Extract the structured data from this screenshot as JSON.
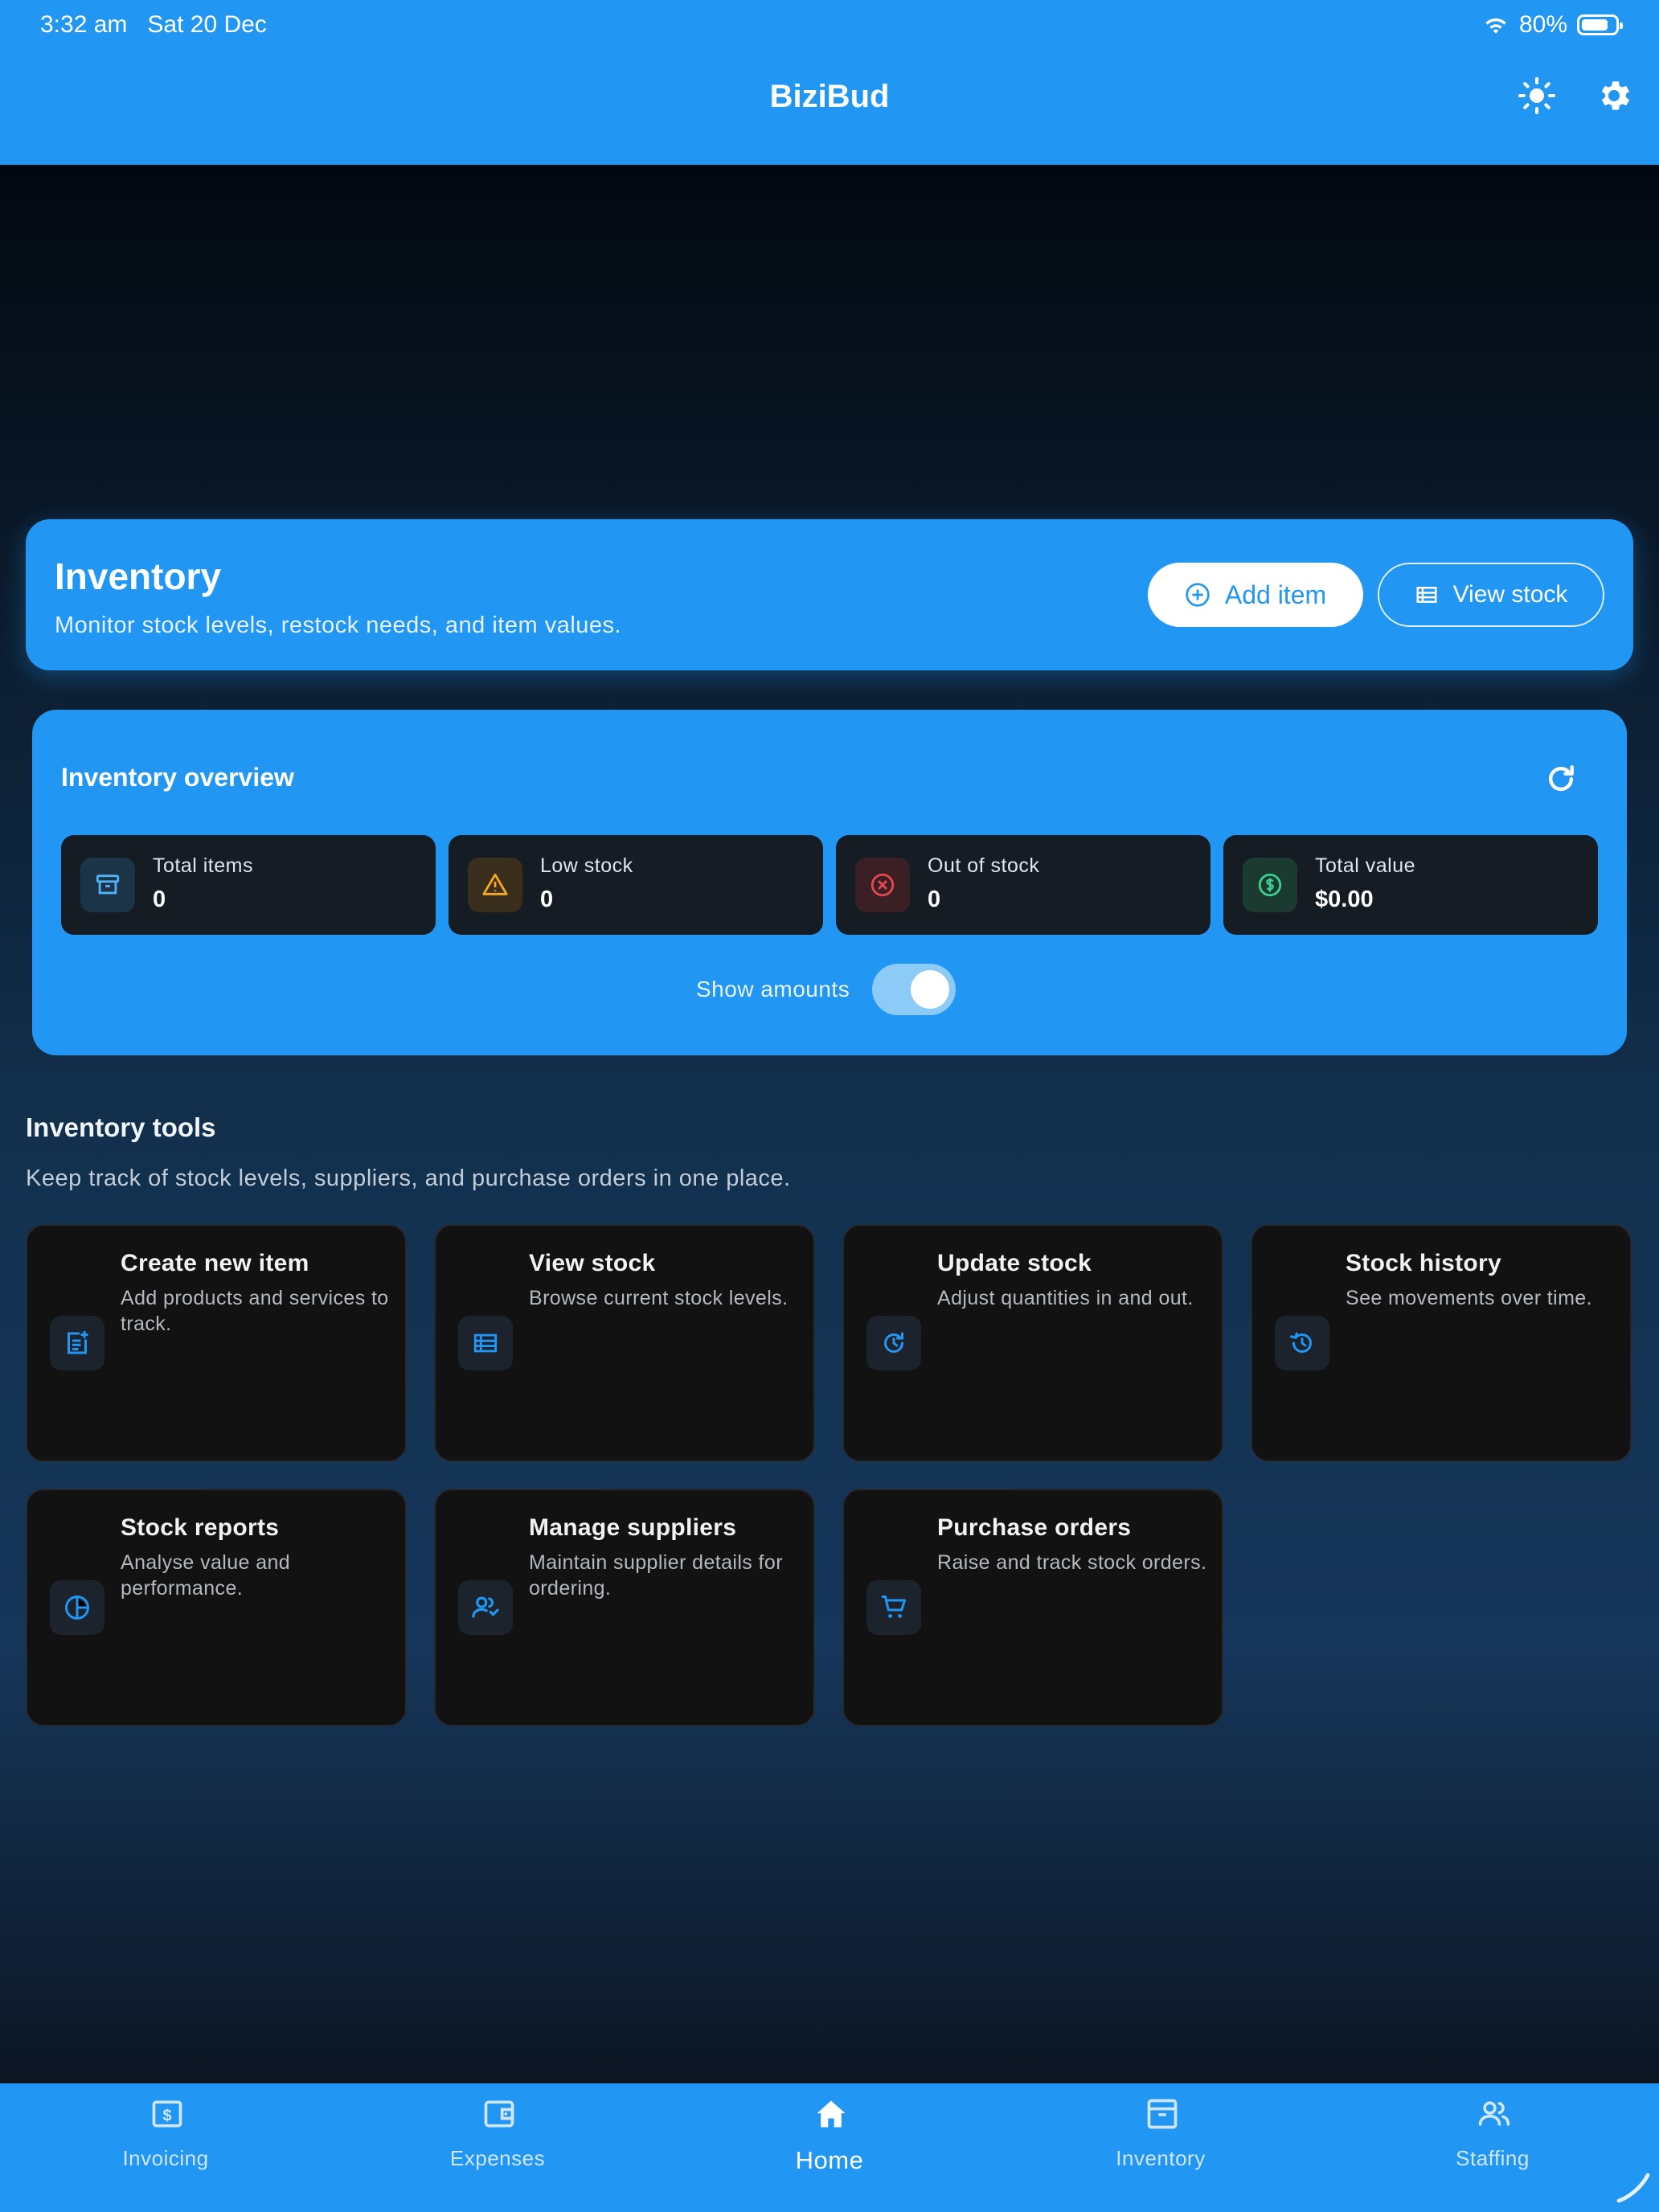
{
  "status_bar": {
    "time": "3:32 am",
    "date": "Sat 20 Dec",
    "battery": "80%"
  },
  "app": {
    "title": "BiziBud"
  },
  "hero": {
    "title": "Inventory",
    "subtitle": "Monitor stock levels, restock needs, and item values.",
    "add_label": "Add item",
    "view_label": "View stock"
  },
  "overview": {
    "title": "Inventory overview",
    "stats": [
      {
        "label": "Total items",
        "value": "0",
        "icon": "archive-icon",
        "color": "#4fb3f6"
      },
      {
        "label": "Low stock",
        "value": "0",
        "icon": "warning-icon",
        "color": "#f5a623"
      },
      {
        "label": "Out of stock",
        "value": "0",
        "icon": "x-circle-icon",
        "color": "#e5484d"
      },
      {
        "label": "Total value",
        "value": "$0.00",
        "icon": "dollar-circle-icon",
        "color": "#3ecf8e"
      }
    ],
    "toggle_label": "Show amounts",
    "toggle_on": true
  },
  "tools": {
    "title": "Inventory tools",
    "subtitle": "Keep track of stock levels, suppliers, and purchase orders in one place.",
    "items": [
      {
        "title": "Create new item",
        "desc": "Add products and services to track.",
        "icon": "note-add-icon"
      },
      {
        "title": "View stock",
        "desc": "Browse current stock levels.",
        "icon": "list-table-icon"
      },
      {
        "title": "Update stock",
        "desc": "Adjust quantities in and out.",
        "icon": "update-icon"
      },
      {
        "title": "Stock history",
        "desc": "See movements over time.",
        "icon": "history-icon"
      },
      {
        "title": "Stock reports",
        "desc": "Analyse value and performance.",
        "icon": "pie-chart-icon"
      },
      {
        "title": "Manage suppliers",
        "desc": "Maintain supplier details for ordering.",
        "icon": "suppliers-icon"
      },
      {
        "title": "Purchase orders",
        "desc": "Raise and track stock orders.",
        "icon": "cart-icon"
      }
    ]
  },
  "nav": {
    "items": [
      {
        "label": "Invoicing",
        "icon": "invoice-icon"
      },
      {
        "label": "Expenses",
        "icon": "wallet-icon"
      },
      {
        "label": "Home",
        "icon": "home-icon",
        "active": true
      },
      {
        "label": "Inventory",
        "icon": "archive-icon"
      },
      {
        "label": "Staffing",
        "icon": "people-icon"
      }
    ]
  },
  "colors": {
    "primary": "#2196f3",
    "card_dark": "#161c24",
    "tile": "#121212"
  }
}
